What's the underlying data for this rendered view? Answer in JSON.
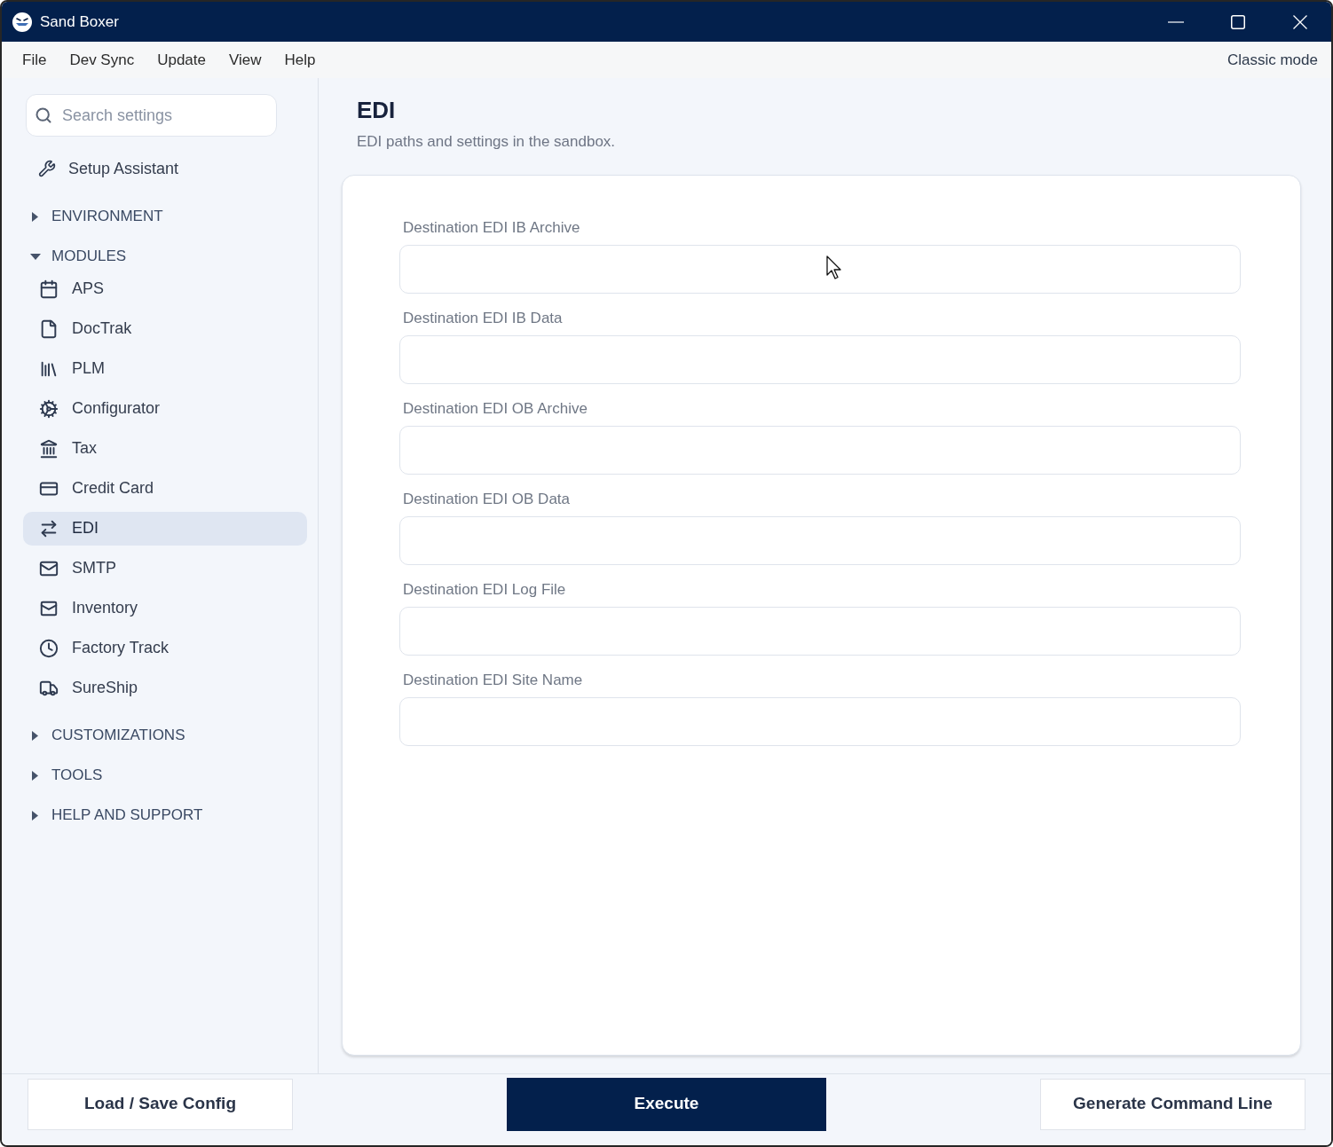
{
  "window": {
    "title": "Sand Boxer"
  },
  "menu_bar": {
    "items": [
      "File",
      "Dev Sync",
      "Update",
      "View",
      "Help"
    ],
    "mode_link": "Classic mode"
  },
  "sidebar": {
    "search": {
      "placeholder": "Search settings"
    },
    "assistant": {
      "label": "Setup Assistant"
    },
    "sections": [
      {
        "label": "ENVIRONMENT",
        "expanded": false
      },
      {
        "label": "MODULES",
        "expanded": true,
        "children": [
          {
            "label": "APS",
            "selected": false
          },
          {
            "label": "DocTrak",
            "selected": false
          },
          {
            "label": "PLM",
            "selected": false
          },
          {
            "label": "Configurator",
            "selected": false
          },
          {
            "label": "Tax",
            "selected": false
          },
          {
            "label": "Credit Card",
            "selected": false
          },
          {
            "label": "EDI",
            "selected": true
          },
          {
            "label": "SMTP",
            "selected": false
          },
          {
            "label": "Inventory",
            "selected": false
          },
          {
            "label": "Factory Track",
            "selected": false
          },
          {
            "label": "SureShip",
            "selected": false
          }
        ]
      },
      {
        "label": "CUSTOMIZATIONS",
        "expanded": false
      },
      {
        "label": "TOOLS",
        "expanded": false
      },
      {
        "label": "HELP AND SUPPORT",
        "expanded": false
      }
    ]
  },
  "page": {
    "title": "EDI",
    "subtitle": "EDI paths and settings in the sandbox.",
    "fields": [
      {
        "label": "Destination EDI IB Archive"
      },
      {
        "label": "Destination EDI IB Data"
      },
      {
        "label": "Destination EDI OB Archive"
      },
      {
        "label": "Destination EDI OB Data"
      },
      {
        "label": "Destination EDI Log File"
      },
      {
        "label": "Destination EDI Site Name"
      }
    ]
  },
  "footer": {
    "buttons": [
      {
        "label": "Load / Save Config",
        "kind": "secondary"
      },
      {
        "label": "Execute",
        "kind": "primary"
      },
      {
        "label": "Generate Command Line",
        "kind": "secondary"
      }
    ]
  }
}
